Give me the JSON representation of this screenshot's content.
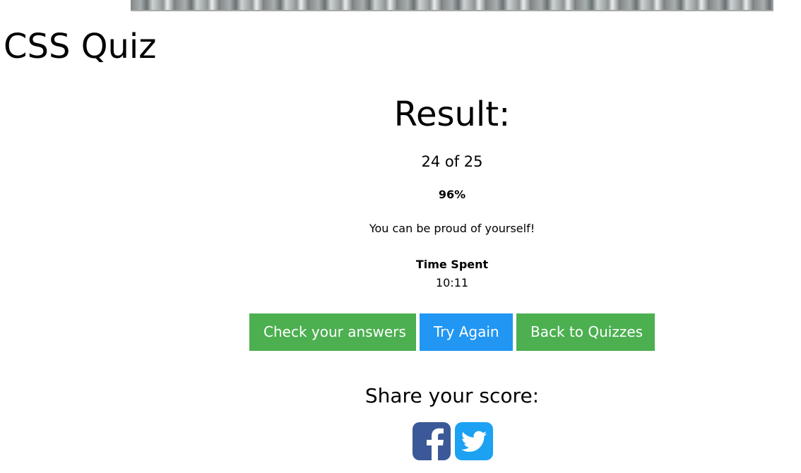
{
  "page": {
    "title": "CSS Quiz"
  },
  "result": {
    "heading": "Result:",
    "score": "24 of 25",
    "percent": "96%",
    "message": "You can be proud of yourself!",
    "time_label": "Time Spent",
    "time_value": "10:11"
  },
  "actions": {
    "check_answers": "Check your answers",
    "try_again": "Try Again",
    "back_to_quizzes": "Back to Quizzes"
  },
  "share": {
    "title": "Share your score:",
    "icons": [
      "facebook-icon",
      "twitter-icon"
    ]
  },
  "colors": {
    "green": "#4caf50",
    "blue": "#2196f3",
    "facebook": "#3b5998",
    "twitter": "#1da1f2"
  }
}
